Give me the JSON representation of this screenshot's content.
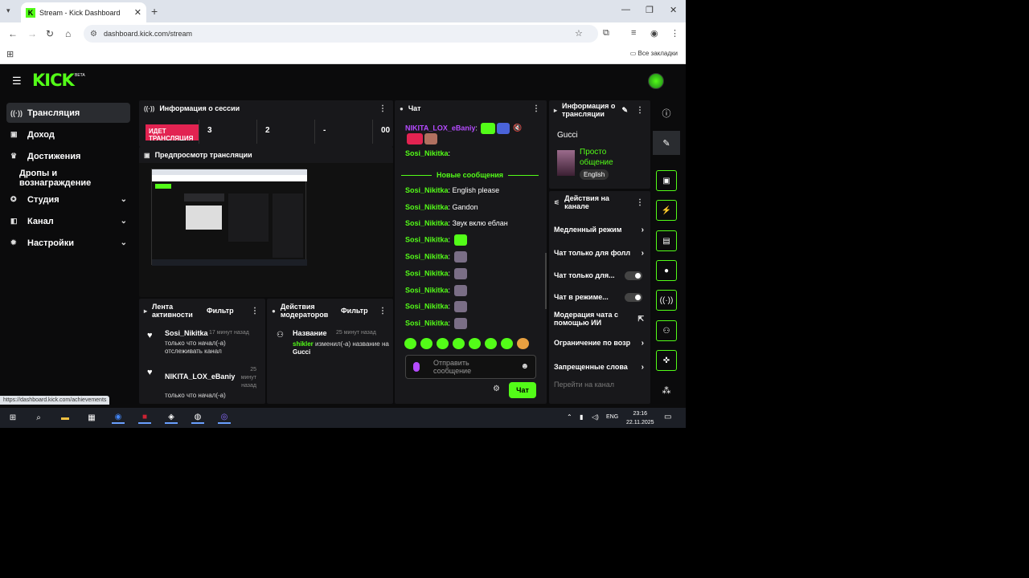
{
  "browser": {
    "tab_title": "Stream - Kick Dashboard",
    "url": "dashboard.kick.com/stream",
    "all_bookmarks": "Все закладки"
  },
  "brand": {
    "logo": "KICK",
    "beta": "BETA",
    "accent": "#53fc18"
  },
  "sidebar": {
    "items": [
      {
        "label": "Трансляция",
        "icon": "broadcast-icon"
      },
      {
        "label": "Доход",
        "icon": "wallet-icon"
      },
      {
        "label": "Достижения",
        "icon": "trophy-icon"
      },
      {
        "label": "Дропы и вознаграждение",
        "icon": ""
      },
      {
        "label": "Студия",
        "icon": "studio-icon"
      },
      {
        "label": "Канал",
        "icon": "channel-icon"
      },
      {
        "label": "Настройки",
        "icon": "settings-icon"
      }
    ]
  },
  "session": {
    "title": "Информация о сессии",
    "live_label": "ИДЕТ ТРАНСЛЯЦИЯ",
    "stats": [
      "3",
      "2",
      "-",
      "00"
    ]
  },
  "preview": {
    "title": "Предпросмотр трансляции"
  },
  "activity": {
    "title": "Лента активности",
    "filter": "Фильтр",
    "items": [
      {
        "user": "Sosi_Nikitka",
        "time": "17 минут назад",
        "text": "только что начал(-а) отслеживать канал"
      },
      {
        "user": "NIKITA_LOX_eBaniy",
        "time": "25 минут назад",
        "text": "только что начал(-а)"
      }
    ]
  },
  "modactions": {
    "title": "Действия модераторов",
    "filter": "Фильтр",
    "item": {
      "name": "Название",
      "time": "25 минут назад",
      "user": "shikler",
      "text": "изменил(-а) название на",
      "value": "Gucci"
    }
  },
  "chat": {
    "title": "Чат",
    "top_user": "NIKITA_LOX_eBaniy",
    "new_messages": "Новые сообщения",
    "messages": [
      {
        "user": "Sosi_Nikitka",
        "text": "English please"
      },
      {
        "user": "Sosi_Nikitka",
        "text": "Gandon"
      },
      {
        "user": "Sosi_Nikitka",
        "text": "Звук вклю еблан"
      }
    ],
    "emote_user": "Sosi_Nikitka",
    "input_placeholder": "Отправить сообщение",
    "send": "Чат"
  },
  "streaminfo": {
    "title": "Информация о трансляции",
    "stream_title": "Gucci",
    "category": "Просто общение",
    "language": "English"
  },
  "channelactions": {
    "title": "Действия на канале",
    "items": [
      "Медленный режим",
      "Чат только для фолл",
      "Чат только для...",
      "Чат в режиме...",
      "Модерация чата с помощью ИИ",
      "Ограничение по возр",
      "Запрещенные слова"
    ],
    "goto": "Перейти на канал"
  },
  "status_url": "https://dashboard.kick.com/achievements",
  "taskbar": {
    "lang": "ENG",
    "time": "23:16",
    "date": "22.11.2025"
  }
}
